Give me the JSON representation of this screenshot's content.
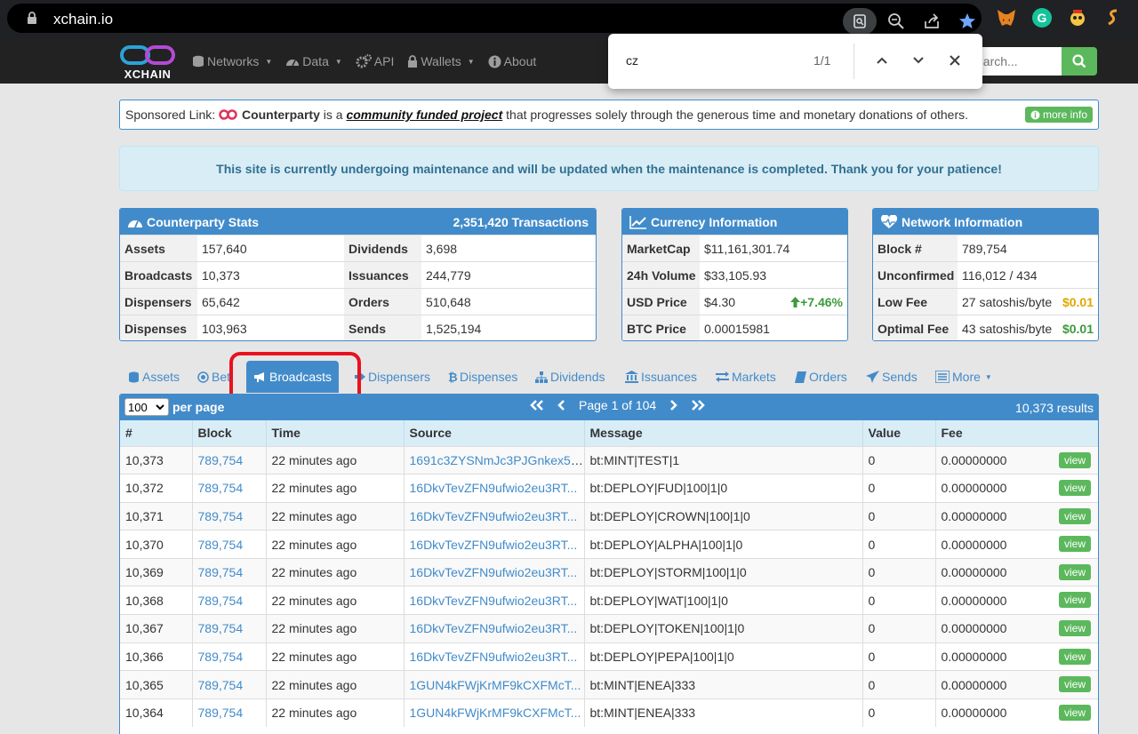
{
  "browser": {
    "url": "xchain.io",
    "icons": [
      "search-page-icon",
      "zoom-icon",
      "share-icon",
      "bookmark-star-icon"
    ],
    "extensions": [
      "metamask-icon",
      "grammarly-icon",
      "extension-icon",
      "swap-icon"
    ]
  },
  "find": {
    "query": "cz",
    "count": "1/1"
  },
  "navbar": {
    "logo_text": "XCHAIN",
    "items": [
      {
        "label": "Networks",
        "dropdown": true,
        "icon": "database-icon"
      },
      {
        "label": "Data",
        "dropdown": true,
        "icon": "dashboard-icon"
      },
      {
        "label": "API",
        "dropdown": false,
        "icon": "cogs-icon"
      },
      {
        "label": "Wallets",
        "dropdown": true,
        "icon": "lock-icon"
      },
      {
        "label": "About",
        "dropdown": false,
        "icon": "info-icon"
      }
    ],
    "search_placeholder": "earch..."
  },
  "sponsor": {
    "prefix": "Sponsored Link:",
    "name": "Counterparty",
    "mid": "is a",
    "link": "community funded project",
    "suffix": "that progresses solely through the generous time and monetary donations of others.",
    "more_info": "more info"
  },
  "alert": "This site is currently undergoing maintenance and will be updated when the maintenance is completed. Thank you for your patience!",
  "stats": {
    "title": "Counterparty Stats",
    "transactions": "2,351,420 Transactions",
    "rows": [
      {
        "l1": "Assets",
        "v1": "157,640",
        "l2": "Dividends",
        "v2": "3,698"
      },
      {
        "l1": "Broadcasts",
        "v1": "10,373",
        "l2": "Issuances",
        "v2": "244,779"
      },
      {
        "l1": "Dispensers",
        "v1": "65,642",
        "l2": "Orders",
        "v2": "510,648"
      },
      {
        "l1": "Dispenses",
        "v1": "103,963",
        "l2": "Sends",
        "v2": "1,525,194"
      }
    ]
  },
  "currency": {
    "title": "Currency Information",
    "rows": [
      {
        "label": "MarketCap",
        "value": "$11,161,301.74",
        "extra": ""
      },
      {
        "label": "24h Volume",
        "value": "$33,105.93",
        "extra": ""
      },
      {
        "label": "USD Price",
        "value": "$4.30",
        "extra": "+7.46%"
      },
      {
        "label": "BTC Price",
        "value": "0.00015981",
        "extra": ""
      }
    ],
    "up_color": "#3c9a3c"
  },
  "network": {
    "title": "Network Information",
    "rows": [
      {
        "label": "Block #",
        "value": "789,754",
        "extra": ""
      },
      {
        "label": "Unconfirmed",
        "value": "116,012 / 434",
        "extra": ""
      },
      {
        "label": "Low Fee",
        "value": "27 satoshis/byte",
        "extra": "$0.01"
      },
      {
        "label": "Optimal Fee",
        "value": "43 satoshis/byte",
        "extra": "$0.01"
      }
    ]
  },
  "tabs": [
    {
      "label": "Assets",
      "icon": "database-icon"
    },
    {
      "label": "Bet",
      "icon": "target-icon"
    },
    {
      "label": "Broadcasts",
      "icon": "bullhorn-icon",
      "active": true
    },
    {
      "label": "Dispensers",
      "icon": "arrow-icon"
    },
    {
      "label": "Dispenses",
      "icon": "bitcoin-icon"
    },
    {
      "label": "Dividends",
      "icon": "sitemap-icon"
    },
    {
      "label": "Issuances",
      "icon": "bank-icon"
    },
    {
      "label": "Markets",
      "icon": "exchange-icon"
    },
    {
      "label": "Orders",
      "icon": "book-icon"
    },
    {
      "label": "Sends",
      "icon": "send-icon"
    },
    {
      "label": "More",
      "icon": "list-icon",
      "dropdown": true
    }
  ],
  "table": {
    "per_page": "100",
    "per_page_label": "per page",
    "page_text": "Page 1 of 104",
    "results": "10,373 results",
    "columns": [
      "#",
      "Block",
      "Time",
      "Source",
      "Message",
      "Value",
      "Fee"
    ],
    "view_label": "view",
    "rows": [
      {
        "n": "10,373",
        "block": "789,754",
        "time": "22 minutes ago",
        "source": "1691c3ZYSNmJc3PJGnkex5f...",
        "message": "bt:MINT|TEST|1",
        "value": "0",
        "fee": "0.00000000"
      },
      {
        "n": "10,372",
        "block": "789,754",
        "time": "22 minutes ago",
        "source": "16DkvTevZFN9ufwio2eu3RT...",
        "message": "bt:DEPLOY|FUD|100|1|0",
        "value": "0",
        "fee": "0.00000000"
      },
      {
        "n": "10,371",
        "block": "789,754",
        "time": "22 minutes ago",
        "source": "16DkvTevZFN9ufwio2eu3RT...",
        "message": "bt:DEPLOY|CROWN|100|1|0",
        "value": "0",
        "fee": "0.00000000"
      },
      {
        "n": "10,370",
        "block": "789,754",
        "time": "22 minutes ago",
        "source": "16DkvTevZFN9ufwio2eu3RT...",
        "message": "bt:DEPLOY|ALPHA|100|1|0",
        "value": "0",
        "fee": "0.00000000"
      },
      {
        "n": "10,369",
        "block": "789,754",
        "time": "22 minutes ago",
        "source": "16DkvTevZFN9ufwio2eu3RT...",
        "message": "bt:DEPLOY|STORM|100|1|0",
        "value": "0",
        "fee": "0.00000000"
      },
      {
        "n": "10,368",
        "block": "789,754",
        "time": "22 minutes ago",
        "source": "16DkvTevZFN9ufwio2eu3RT...",
        "message": "bt:DEPLOY|WAT|100|1|0",
        "value": "0",
        "fee": "0.00000000"
      },
      {
        "n": "10,367",
        "block": "789,754",
        "time": "22 minutes ago",
        "source": "16DkvTevZFN9ufwio2eu3RT...",
        "message": "bt:DEPLOY|TOKEN|100|1|0",
        "value": "0",
        "fee": "0.00000000"
      },
      {
        "n": "10,366",
        "block": "789,754",
        "time": "22 minutes ago",
        "source": "16DkvTevZFN9ufwio2eu3RT...",
        "message": "bt:DEPLOY|PEPA|100|1|0",
        "value": "0",
        "fee": "0.00000000"
      },
      {
        "n": "10,365",
        "block": "789,754",
        "time": "22 minutes ago",
        "source": "1GUN4kFWjKrMF9kCXFMcT...",
        "message": "bt:MINT|ENEA|333",
        "value": "0",
        "fee": "0.00000000"
      },
      {
        "n": "10,364",
        "block": "789,754",
        "time": "22 minutes ago",
        "source": "1GUN4kFWjKrMF9kCXFMcT...",
        "message": "bt:MINT|ENEA|333",
        "value": "0",
        "fee": "0.00000000"
      }
    ]
  },
  "colors": {
    "primary": "#428bca",
    "success": "#5cb85c",
    "highlight": "#e8121f",
    "fee_usd": "#e0a800"
  }
}
